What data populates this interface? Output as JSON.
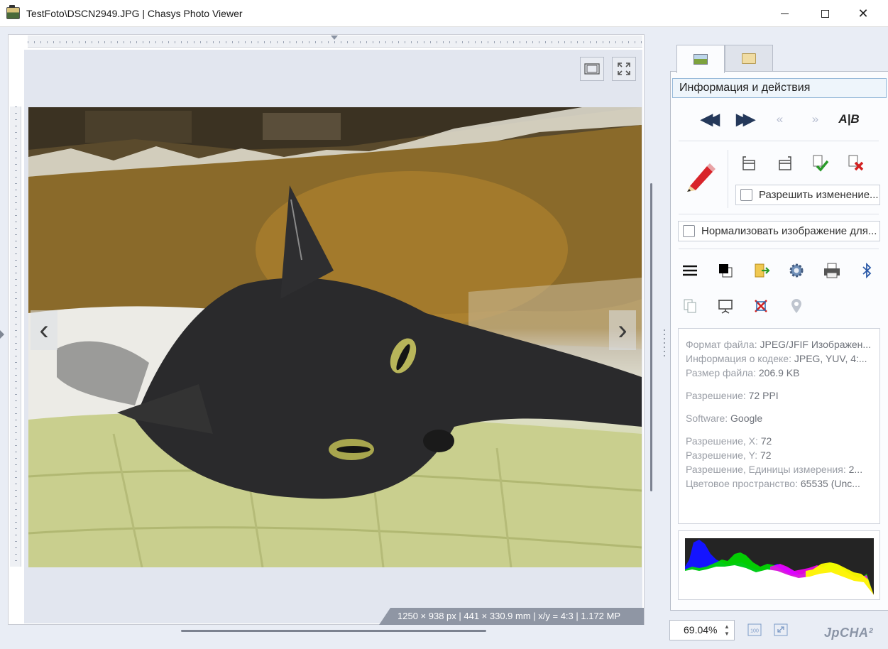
{
  "window": {
    "title": "TestFoto\\DSCN2949.JPG | Chasys Photo Viewer",
    "minimize": "—",
    "maximize": "☐",
    "close": "✕"
  },
  "viewer": {
    "prev_arrow": "‹",
    "next_arrow": "›",
    "status": "1250 × 938 px | 441 × 330.9 mm | x/y = 4:3 | 1.172 MP"
  },
  "panel": {
    "tabs": [
      {
        "name": "image-info-tab",
        "icon": "image-icon",
        "active": true
      },
      {
        "name": "folder-tab",
        "icon": "folder-icon",
        "active": false
      }
    ],
    "header": "Информация и действия",
    "nav": {
      "first": "◀◀",
      "last": "▶▶",
      "prev": "«",
      "next": "»",
      "compare": "A|B"
    },
    "allow_edit_label": "Разрешить изменение...",
    "normalize_label": "Нормализовать изображение для...",
    "info": [
      {
        "label": "Формат файла:",
        "value": "JPEG/JFIF Изображен..."
      },
      {
        "label": "Информация о кодеке:",
        "value": "JPEG, YUV, 4:..."
      },
      {
        "label": "Размер файла:",
        "value": "206.9 KB"
      },
      {
        "label": "Разрешение:",
        "value": "72 PPI"
      },
      {
        "label": "Software:",
        "value": "Google"
      },
      {
        "label": "Разрешение, X:",
        "value": "72"
      },
      {
        "label": "Разрешение, Y:",
        "value": "72"
      },
      {
        "label": "Разрешение, Единицы измерения:",
        "value": "2..."
      },
      {
        "label": "Цветовое пространство:",
        "value": "65535 (Unc..."
      }
    ]
  },
  "bottom": {
    "zoom": "69.04%",
    "zoom_100_label": "100",
    "logo": "JpCHA²"
  },
  "colors": {
    "accent_blue": "#95b8d8",
    "status_bar": "#8f96a4",
    "icon_nav": "#24385a"
  }
}
